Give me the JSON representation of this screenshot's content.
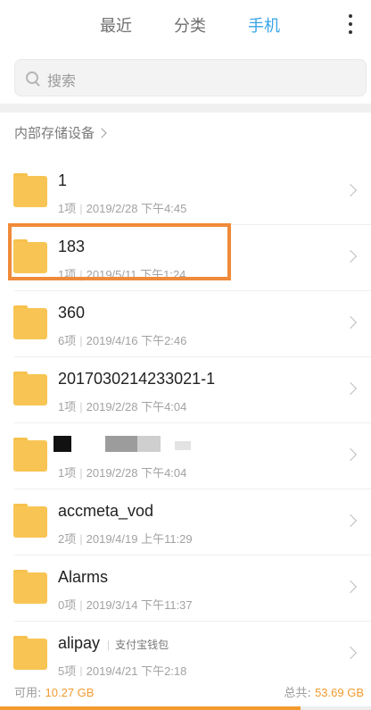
{
  "tabs": [
    {
      "label": "最近"
    },
    {
      "label": "分类"
    },
    {
      "label": "手机"
    }
  ],
  "search": {
    "placeholder": "搜索"
  },
  "breadcrumb": {
    "label": "内部存储设备"
  },
  "files": [
    {
      "name": "1",
      "meta_count": "1项",
      "meta_time": "2019/2/28 下午4:45"
    },
    {
      "name": "183",
      "meta_count": "1项",
      "meta_time": "2019/5/11 下午1:24"
    },
    {
      "name": "360",
      "meta_count": "6项",
      "meta_time": "2019/4/16 下午2:46"
    },
    {
      "name": "2017030214233021-1",
      "meta_count": "1项",
      "meta_time": "2019/2/28 下午4:04"
    },
    {
      "name": "",
      "meta_count": "1项",
      "meta_time": "2019/2/28 下午4:04"
    },
    {
      "name": "accmeta_vod",
      "meta_count": "2项",
      "meta_time": "2019/4/19 上午11:29"
    },
    {
      "name": "Alarms",
      "meta_count": "0项",
      "meta_time": "2019/3/14 下午11:37"
    },
    {
      "name": "alipay",
      "tag": "支付宝钱包",
      "meta_count": "5项",
      "meta_time": "2019/4/21 下午2:18"
    }
  ],
  "storage": {
    "available_label": "可用:",
    "available_value": "10.27 GB",
    "total_label": "总共:",
    "total_value": "53.69 GB",
    "used_fraction": 0.81
  },
  "colors": {
    "accent": "#3aa4e6",
    "folder": "#f8c554",
    "highlight": "#f08a3a",
    "storage": "#f29a2e"
  }
}
